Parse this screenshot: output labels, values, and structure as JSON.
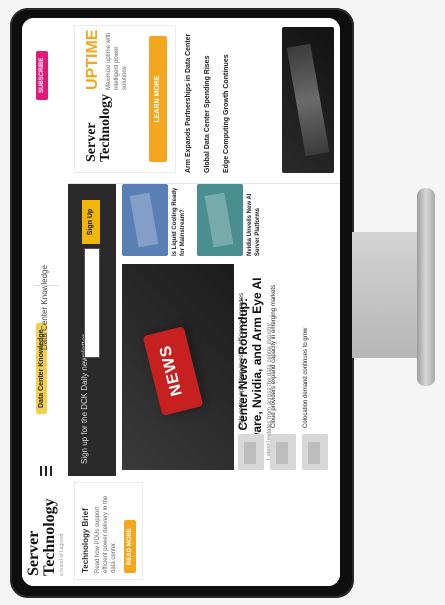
{
  "brand": {
    "name_line1": "Server",
    "name_line2": "Technology",
    "tagline": "a brand of Legrand"
  },
  "header": {
    "site_title": "Data Center Knowledge",
    "subscribe_label": "SUBSCRIBE"
  },
  "newsletter": {
    "text": "Sign up for the DCK Daily newsletter",
    "button_label": "Sign Up"
  },
  "hero": {
    "headline": "Data Center News Roundup: VMware, Nvidia, and Arm Eye AI",
    "dek": "Latest updates from across the data center industry",
    "image_text": "NEWS"
  },
  "left_col": {
    "promo_title": "Technology Brief",
    "promo_lines": "Read how PDUs support efficient power delivery in the data center.",
    "promo_button": "READ MORE"
  },
  "side_stories": [
    {
      "title": "Is Liquid Cooling Ready for Mainstream?"
    },
    {
      "title": "Nvidia Unveils New AI Server Platforms"
    }
  ],
  "story_list": [
    {
      "text": "Data center operators invest in efficiency upgrades"
    },
    {
      "text": "Cloud providers expand capacity in emerging markets"
    },
    {
      "text": "Colocation demand continues to grow"
    }
  ],
  "right_col": {
    "uptime": "UPTIME",
    "rail_tag": "Maximize uptime with intelligent power solutions",
    "rail_button": "LEARN MORE",
    "rail_headlines": [
      "Arm Expands Partnerships in Data Center",
      "Global Data Center Spending Rises",
      "Edge Computing Growth Continues"
    ]
  }
}
